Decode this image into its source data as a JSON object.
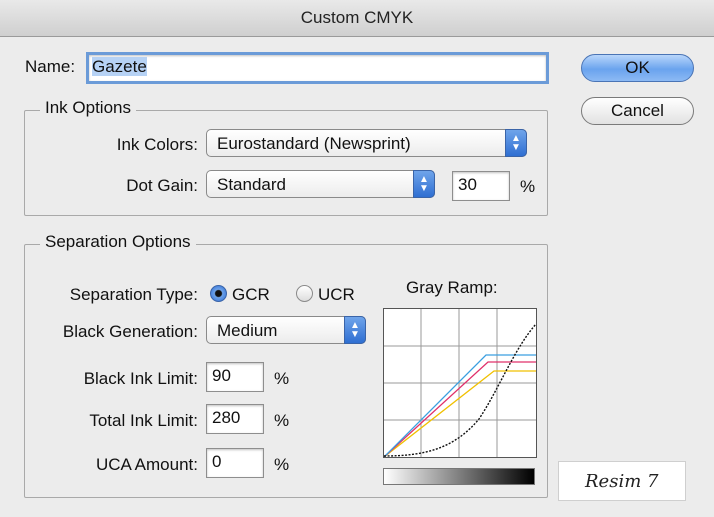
{
  "window": {
    "title": "Custom CMYK"
  },
  "name_field": {
    "label": "Name:",
    "value": "Gazete"
  },
  "buttons": {
    "ok": "OK",
    "cancel": "Cancel"
  },
  "ink_options": {
    "legend": "Ink Options",
    "ink_colors_label": "Ink Colors:",
    "ink_colors_value": "Eurostandard (Newsprint)",
    "dot_gain_label": "Dot Gain:",
    "dot_gain_value": "Standard",
    "dot_gain_amount": "30",
    "dot_gain_unit": "%"
  },
  "separation_options": {
    "legend": "Separation Options",
    "separation_type_label": "Separation Type:",
    "gcr_label": "GCR",
    "ucr_label": "UCR",
    "selected_type": "GCR",
    "black_generation_label": "Black Generation:",
    "black_generation_value": "Medium",
    "black_ink_limit_label": "Black Ink Limit:",
    "black_ink_limit_value": "90",
    "total_ink_limit_label": "Total Ink Limit:",
    "total_ink_limit_value": "280",
    "uca_amount_label": "UCA Amount:",
    "uca_amount_value": "0",
    "percent": "%",
    "gray_ramp_label": "Gray Ramp:"
  },
  "gray_ramp_colors": {
    "cyan": "#3a9fe0",
    "magenta": "#e0306a",
    "yellow": "#f0c000",
    "black": "#111111"
  },
  "caption": "Resim 7"
}
